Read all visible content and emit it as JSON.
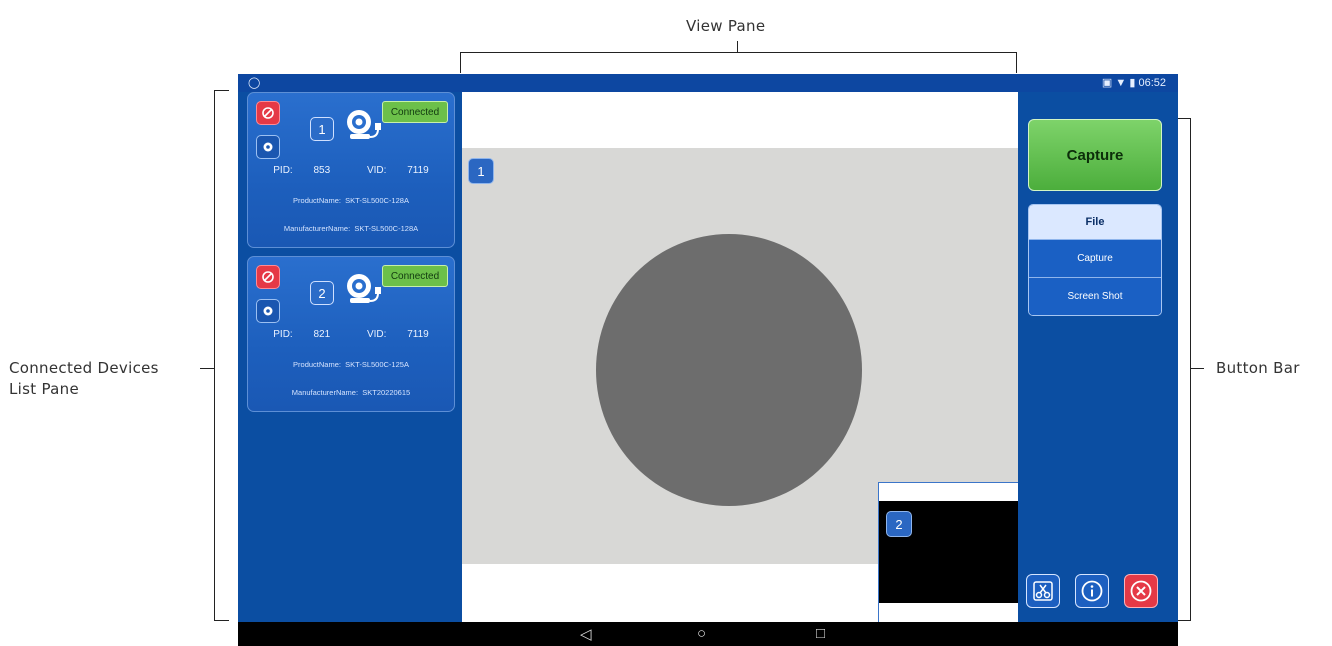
{
  "annotations": {
    "view_pane": "View Pane",
    "devices_pane_line1": "Connected Devices",
    "devices_pane_line2": "List Pane",
    "button_bar": "Button Bar"
  },
  "status_bar": {
    "time": "06:52"
  },
  "devices": [
    {
      "index": "1",
      "status": "Connected",
      "pid_label": "PID:",
      "pid": "853",
      "vid_label": "VID:",
      "vid": "7119",
      "product_label": "ProductName:",
      "product": "SKT-SL500C-128A",
      "manufacturer_label": "ManufacturerName:",
      "manufacturer": "SKT-SL500C-128A"
    },
    {
      "index": "2",
      "status": "Connected",
      "pid_label": "PID:",
      "pid": "821",
      "vid_label": "VID:",
      "vid": "7119",
      "product_label": "ProductName:",
      "product": "SKT-SL500C-125A",
      "manufacturer_label": "ManufacturerName:",
      "manufacturer": "SKT20220615"
    }
  ],
  "view": {
    "main_index": "1",
    "pip_index": "2"
  },
  "button_bar": {
    "capture": "Capture",
    "file_menu": {
      "title": "File",
      "items": [
        "Capture",
        "Screen Shot"
      ]
    },
    "icons": [
      "scissors-icon",
      "info-icon",
      "close-icon"
    ]
  },
  "colors": {
    "panel_blue": "#0b4ea2",
    "capture_green": "#5cbf45",
    "disconnect_red": "#e53946"
  }
}
